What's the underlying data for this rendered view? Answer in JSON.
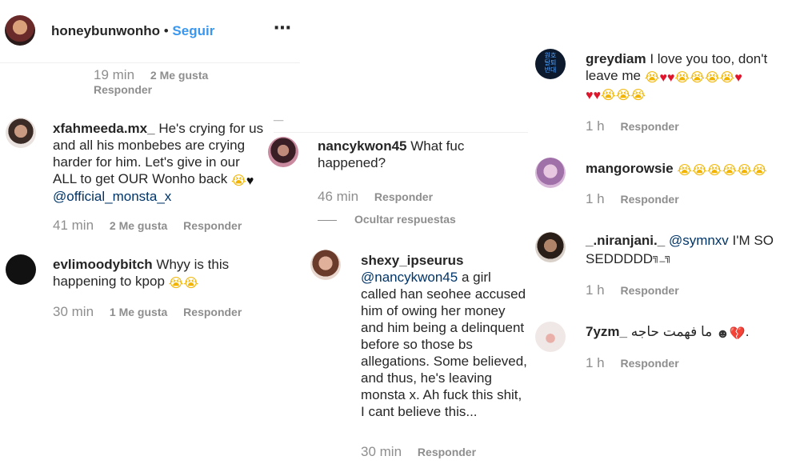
{
  "header": {
    "username": "honeybunwonho",
    "separator": "•",
    "follow_label": "Seguir",
    "more_icon": "⋯"
  },
  "left": {
    "top_meta": {
      "time": "19 min",
      "likes": "2 Me gusta",
      "reply": "Responder"
    },
    "comments": [
      {
        "username": "xfahmeeda.mx_",
        "text_lines": [
          "He's crying for us",
          "and all his monbebes are crying",
          "harder for him. Let's give in our",
          "ALL to get OUR Wonho back"
        ],
        "mention": "@official_monsta_x",
        "time": "41 min",
        "likes": "2 Me gusta",
        "reply": "Responder"
      },
      {
        "username": "evlimoodybitch",
        "text_lines": [
          "Whyy is this",
          "happening to kpop"
        ],
        "time": "30 min",
        "likes": "1 Me gusta",
        "reply": "Responder"
      }
    ]
  },
  "middle": {
    "top_rule": "__",
    "comment": {
      "username": "nancykwon45",
      "text_lines": [
        "What fuc",
        "happened?"
      ],
      "time": "46 min",
      "reply": "Responder"
    },
    "hide_replies": "Ocultar respuestas",
    "reply": {
      "username": "shexy_ipseurus",
      "mention": "@nancykwon45",
      "text_lines": [
        "a girl",
        "called han seohee accused",
        "him of owing her money",
        "and him being a delinquent",
        "before so those bs",
        "allegations. Some believed,",
        "and thus, he's leaving",
        "monsta x. Ah fuck this shit,",
        "I cant believe this..."
      ],
      "time": "30 min",
      "reply": "Responder"
    }
  },
  "right": {
    "comments": [
      {
        "username": "greydiam",
        "text_lines": [
          "I love you too, don't",
          "leave me"
        ],
        "time": "1 h",
        "reply": "Responder"
      },
      {
        "username": "mangorowsie",
        "time": "1 h",
        "reply": "Responder"
      },
      {
        "username": "_.niranjani._",
        "mention": "@symnxv",
        "text_lines": [
          "I'M SO",
          "SEDDDDD"
        ],
        "suffix": "╗_╗",
        "time": "1 h",
        "reply": "Responder"
      },
      {
        "username": "7yzm_",
        "text_lines": [
          "ما فهمت حاجه"
        ],
        "trail": ".",
        "time": "1 h",
        "reply": "Responder"
      }
    ]
  },
  "emoji": {
    "cry": "😭",
    "heart": "♥",
    "black_heart": "♥",
    "broken_heart": "💔",
    "dark_face": "☻"
  },
  "avatar_texts": {
    "greydiam": [
      "원호",
      "탈퇴",
      "반대"
    ]
  },
  "colors": {
    "link": "#003569",
    "follow": "#3897f0",
    "meta": "#8e8e8e",
    "heart": "#e0142a"
  }
}
